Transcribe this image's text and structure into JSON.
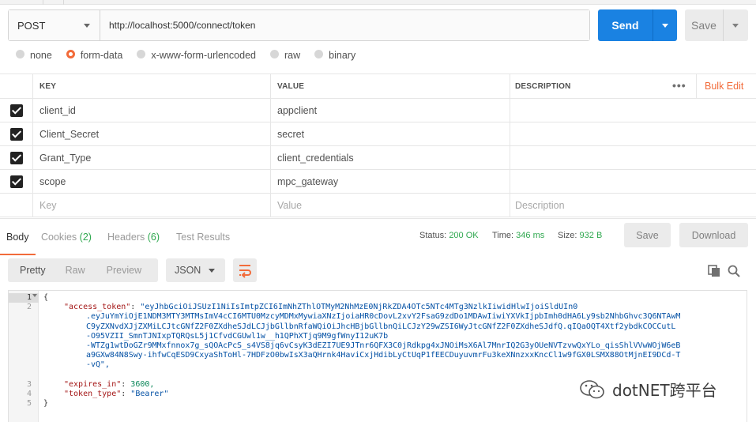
{
  "request": {
    "method": "POST",
    "url": "http://localhost:5000/connect/token",
    "send_label": "Send",
    "save_label": "Save"
  },
  "body_types": [
    {
      "label": "none",
      "selected": false
    },
    {
      "label": "form-data",
      "selected": true
    },
    {
      "label": "x-www-form-urlencoded",
      "selected": false
    },
    {
      "label": "raw",
      "selected": false
    },
    {
      "label": "binary",
      "selected": false
    }
  ],
  "params": {
    "headers": {
      "key": "KEY",
      "value": "VALUE",
      "description": "DESCRIPTION",
      "more": "•••",
      "bulk_edit": "Bulk Edit"
    },
    "rows": [
      {
        "key": "client_id",
        "value": "appclient",
        "checked": true
      },
      {
        "key": "Client_Secret",
        "value": "secret",
        "checked": true
      },
      {
        "key": "Grant_Type",
        "value": "client_credentials",
        "checked": true
      },
      {
        "key": "scope",
        "value": "mpc_gateway",
        "checked": true
      }
    ],
    "placeholders": {
      "key": "Key",
      "value": "Value",
      "description": "Description"
    }
  },
  "response": {
    "tabs": {
      "body": "Body",
      "cookies": "Cookies",
      "cookies_count": "(2)",
      "headers": "Headers",
      "headers_count": "(6)",
      "tests": "Test Results"
    },
    "status_label": "Status:",
    "status_value": "200 OK",
    "time_label": "Time:",
    "time_value": "346 ms",
    "size_label": "Size:",
    "size_value": "932 B",
    "save_label": "Save",
    "download_label": "Download",
    "view_modes": {
      "pretty": "Pretty",
      "raw": "Raw",
      "preview": "Preview"
    },
    "format": "JSON",
    "code": {
      "line_numbers": [
        "1",
        "2",
        "3",
        "4",
        "5"
      ],
      "l1": "{",
      "access_token_key": "\"access_token\"",
      "token_lines": [
        "\"eyJhbGciOiJSUzI1NiIsImtpZCI6ImNhZThlOTMyM2NhMzE0NjRkZDA4OTc5NTc4MTg3NzlkIiwidHlwIjoiSldUIn0",
        ".eyJuYmYiOjE1NDM3MTY3MTMsImV4cCI6MTU0MzcyMDMxMywiaXNzIjoiaHR0cDovL2xvY2FsaG9zdDo1MDAwIiwiYXVkIjpbImh0dHA6Ly9sb2NhbGhvc3Q6NTAwM",
        "C9yZXNvdXJjZXMiLCJtcGNfZ2F0ZXdheSJdLCJjbGllbnRfaWQiOiJhcHBjbGllbnQiLCJzY29wZSI6WyJtcGNfZ2F0ZXdheSJdfQ.qIQaOQT4Xtf2ybdkCOCCutL",
        "-O95VZII_SmnTJNIxpTQRQsL5j1CfvdCGUwl1w__h1QPhXTjq9M9gfWnyI12uK7b",
        "-WTZg1wtDoGZr9MMxfnnox7g_sQOAcPcS_s4VS8jq6vCsyK3dEZI7UE9JTnr6QFX3C0jRdkpg4xJNOiMsX6Al7MnrIQ2G3yOUeNVTzvwQxYLo_qisShlVVwWOjW6eB",
        "a9GXw84N8Swy-ihfwCqESD9CxyaShToHl-7HDFzO0bwIsX3aQHrnk4HaviCxjHdibLyCtUqP1fEECDuyuvmrFu3keXNnzxxKncCl1w9fGX0LSMX88OtMjnEI9DCd-T",
        "-vQ\","
      ],
      "expires_key": "\"expires_in\"",
      "expires_value": "3600,",
      "token_type_key": "\"token_type\"",
      "token_type_value": "\"Bearer\"",
      "l5": "}"
    }
  },
  "watermark": "dotNET跨平台",
  "colors": {
    "accent": "#f26b3a",
    "send": "#1a82e2",
    "ok": "#2fa84f"
  }
}
